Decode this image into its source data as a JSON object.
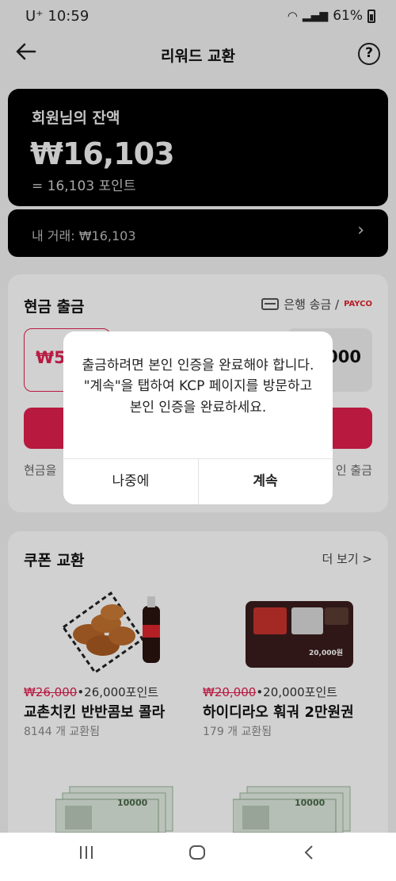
{
  "status_bar": {
    "carrier": "U⁺ 10:59",
    "battery": "61%"
  },
  "header": {
    "title": "리워드 교환",
    "help_label": "?"
  },
  "balance": {
    "label": "회원님의 잔액",
    "amount": "₩16,103",
    "points": "= 16,103 포인트"
  },
  "transactions": {
    "label": "내 거래: ₩16,103"
  },
  "cash_withdrawal": {
    "title": "현금 출금",
    "method_label": "은행 송금 /",
    "method_brand": "PAYCO",
    "first_amount": "₩5,",
    "last_amount": "0,000",
    "note_left": "현금을 ",
    "note_right": "인 출금"
  },
  "coupons": {
    "title": "쿠폰 교환",
    "more_label": "더 보기 >",
    "items": [
      {
        "old_price": "₩26,000",
        "price": "•26,000포인트",
        "name": "교촌치킨 반반콤보 콜라",
        "count": "8144 개 교환됨"
      },
      {
        "old_price": "₩20,000",
        "price": "•20,000포인트",
        "name": "하이디라오 훠궈 2만원권",
        "count": "179 개 교환됨"
      }
    ],
    "voucher_amount": "20,000원",
    "banknote_value": "10000"
  },
  "dialog": {
    "message": "출금하려면 본인 인증을 완료해야 합니다. \"계속\"을 탭하여 KCP 페이지를 방문하고 본인 인증을 완료하세요.",
    "later_label": "나중에",
    "continue_label": "계속"
  },
  "colors": {
    "accent": "#e0204c",
    "balance_card_bg": "#000000",
    "overlay": "rgba(0,0,0,0.18)"
  }
}
